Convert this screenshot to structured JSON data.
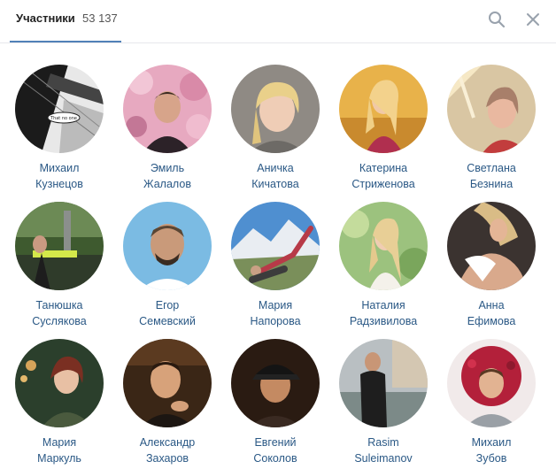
{
  "header": {
    "title": "Участники",
    "count": "53 137",
    "search_icon": "search-icon",
    "close_icon": "close-icon"
  },
  "accent_color": "#5181b8",
  "link_color": "#2a5885",
  "members": [
    {
      "first": "Михаил",
      "last": "Кузнецов"
    },
    {
      "first": "Эмиль",
      "last": "Жалалов"
    },
    {
      "first": "Аничка",
      "last": "Кичатова"
    },
    {
      "first": "Катерина",
      "last": "Стриженова"
    },
    {
      "first": "Светлана",
      "last": "Безнина"
    },
    {
      "first": "Танюшка",
      "last": "Суслякова"
    },
    {
      "first": "Егор",
      "last": "Семевский"
    },
    {
      "first": "Мария",
      "last": "Напорова"
    },
    {
      "first": "Наталия",
      "last": "Радзивилова"
    },
    {
      "first": "Анна",
      "last": "Ефимова"
    },
    {
      "first": "Мария",
      "last": "Маркуль"
    },
    {
      "first": "Александр",
      "last": "Захаров"
    },
    {
      "first": "Евгений",
      "last": "Соколов"
    },
    {
      "first": "Rasim",
      "last": "Suleimanov"
    },
    {
      "first": "Михаил",
      "last": "Зубов"
    }
  ],
  "avatar_badge_text": "That no one"
}
